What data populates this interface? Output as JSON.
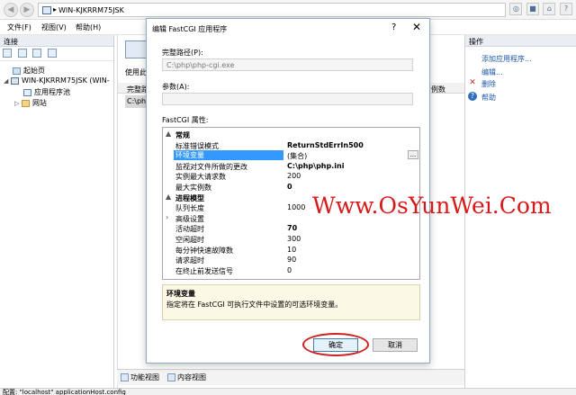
{
  "app": {
    "address": "WIN-KJKRRM75JSK",
    "address_sep": "▸"
  },
  "menu": [
    "文件(F)",
    "视图(V)",
    "帮助(H)"
  ],
  "left_pane": {
    "header": "连接",
    "tree": [
      {
        "label": "起始页",
        "icon": "home-icon"
      },
      {
        "label": "WIN-KJKRRM75JSK (WIN-",
        "icon": "server-icon"
      },
      {
        "label": "应用程序池",
        "icon": "app-pool-icon"
      },
      {
        "label": "网站",
        "icon": "sites-icon"
      }
    ]
  },
  "mid_pane": {
    "text1": "使用此",
    "text2": "完整路",
    "text3": "C:\\ph",
    "text4": "例数"
  },
  "bottom_tabs": [
    "功能视图",
    "内容视图"
  ],
  "right_pane": {
    "header": "操作",
    "actions": [
      "添加应用程序...",
      "编辑...",
      "删除",
      "帮助"
    ]
  },
  "status": "配置: \"localhost\" applicationHost.config",
  "dialog": {
    "title": "编辑 FastCGI 应用程序",
    "help": "?",
    "close": "✕",
    "full_path_label": "完整路径(P):",
    "full_path_value": "C:\\php\\php-cgi.exe",
    "args_label": "参数(A):",
    "args_value": "",
    "props_label": "FastCGI 属性:",
    "properties": [
      {
        "type": "category",
        "name": "常规",
        "expander": "▲"
      },
      {
        "type": "prop",
        "name": "标准错误模式",
        "value": "ReturnStdErrIn500",
        "bold": true
      },
      {
        "type": "prop",
        "name": "环境变量",
        "value": "(集合)",
        "selected": true,
        "ellipsis": "..."
      },
      {
        "type": "prop",
        "name": "监视对文件所做的更改",
        "value": "C:\\php\\php.ini",
        "bold": true
      },
      {
        "type": "prop",
        "name": "实例最大请求数",
        "value": "200"
      },
      {
        "type": "prop",
        "name": "最大实例数",
        "value": "0",
        "bold": true
      },
      {
        "type": "category",
        "name": "进程模型",
        "expander": "▲"
      },
      {
        "type": "prop",
        "name": "队列长度",
        "value": "1000"
      },
      {
        "type": "prop",
        "name": "高级设置",
        "value": "",
        "expander": "›"
      },
      {
        "type": "prop",
        "name": "活动超时",
        "value": "70",
        "bold": true
      },
      {
        "type": "prop",
        "name": "空闲超时",
        "value": "300"
      },
      {
        "type": "prop",
        "name": "每分钟快速故障数",
        "value": "10"
      },
      {
        "type": "prop",
        "name": "请求超时",
        "value": "90"
      },
      {
        "type": "prop",
        "name": "在终止前发送信号",
        "value": "0"
      }
    ],
    "desc_title": "环境变量",
    "desc_text": "指定将在 FastCGI 可执行文件中设置的可选环境变量。",
    "ok_label": "确定",
    "cancel_label": "取消"
  },
  "watermark": "Www.OsYunWei.Com",
  "colors": {
    "selection": "#3399ff",
    "watermark": "#d81919",
    "highlight_ring": "#d02020"
  }
}
